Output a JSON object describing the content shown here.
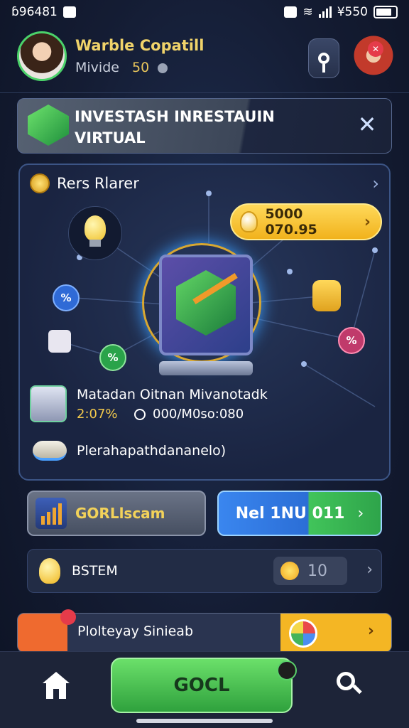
{
  "status_bar": {
    "left_text": "ɓ96481",
    "right_text": "¥550"
  },
  "user": {
    "name": "Warble Copatill",
    "level": "Mivide",
    "coins": "50"
  },
  "banner": {
    "line1": "INVESTASH INRESTAUIN",
    "line2": "VIRTUAL",
    "close_glyph": "✕"
  },
  "panel": {
    "title": "Rers Rlarer",
    "chevron": "›",
    "value_pill": "5000 070.95",
    "nodes": [
      "%",
      "%",
      "%"
    ],
    "stat_title": "Matadan Oitnan Mivanotadk",
    "stat_pct": "2:07%",
    "stat_value": "000/M0so:080",
    "info_text": "Plerahapathdananelo)"
  },
  "actions": {
    "left_label": "GORLlscam",
    "right_label": "Nel 1NU 011",
    "right_arrow": "›"
  },
  "system_row": {
    "label": "BSTEM",
    "count": "10",
    "chevron": "›"
  },
  "promo": {
    "label": "Plolteyay Sinieab",
    "arrow": "›"
  },
  "bottom_nav": {
    "go_label": "GOCL"
  }
}
